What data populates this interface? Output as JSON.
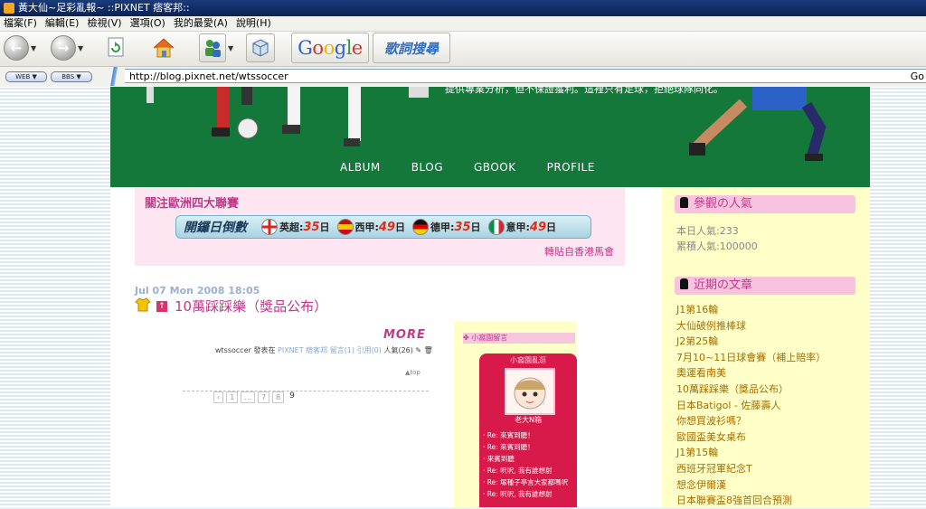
{
  "window": {
    "title": "黃大仙~足彩亂報~ ::PIXNET 痞客邦::"
  },
  "menu": [
    "檔案(F)",
    "編輯(E)",
    "檢視(V)",
    "選項(O)",
    "我的最愛(A)",
    "說明(H)"
  ],
  "toolbar": {
    "google_label": "Google",
    "lyrics_label": "歌詞搜尋",
    "web_label": "WEB",
    "bbs_label": "BBS"
  },
  "address": {
    "url": "http://blog.pixnet.net/wtssoccer",
    "go_label": "Go"
  },
  "header": {
    "tagline": "提供專業分析，但不保證獲利。這裡只有足球，拒絕球隊同化。",
    "nav": [
      "ALBUM",
      "BLOG",
      "GBOOK",
      "PROFILE"
    ]
  },
  "notice": {
    "heading": "關注歐洲四大聯賽",
    "countdown_title": "開鑼日倒數",
    "leagues": [
      {
        "name": "英超:",
        "days": "35",
        "unit": "日",
        "flag": "england-flag-icon"
      },
      {
        "name": "西甲:",
        "days": "49",
        "unit": "日",
        "flag": "spain-flag-icon"
      },
      {
        "name": "德甲:",
        "days": "35",
        "unit": "日",
        "flag": "germany-flag-icon"
      },
      {
        "name": "意甲:",
        "days": "49",
        "unit": "日",
        "flag": "italy-flag-icon"
      }
    ],
    "source": "轉貼自香港馬會"
  },
  "post": {
    "date": "Jul 07 Mon 2008 18:05",
    "title": "10萬踩踩樂（獎品公布）",
    "more_label": "MORE",
    "meta_author": "wtssoccer 發表在",
    "meta_link": "PIXNET 痞客邦 留言(1) 引用(0)",
    "meta_views": "人氣(26)",
    "top_label": "▲top"
  },
  "pager": [
    "‹",
    "1",
    "...",
    "7",
    "8",
    "9"
  ],
  "widget": {
    "bar_label": "小窩園留言",
    "guestbook_title": "小窩園亂逛",
    "guestbook_name": "老大N箱",
    "messages": [
      "Re: 來賓到聽！",
      "Re: 來賓到聽！",
      "來賓到聽",
      "Re: 呎呎, 我有誰想射",
      "Re: 塚種子亭言大家都嗎呎",
      "Re: 呎呎, 我有誰想射"
    ]
  },
  "sidebar": {
    "popularity_head": "參觀の人氣",
    "today": "本日人氣:233",
    "total": "累積人氣:100000",
    "recent_head": "近期の文章",
    "articles": [
      "J1第16輪",
      "大仙破例推棒球",
      "J2第25輪",
      "7月10~11日球會賽（補上賠率）",
      "奧運看南美",
      "10萬踩踩樂（獎品公布）",
      "日本Batigol - 佐藤壽人",
      "你想買波衫嗎？",
      "歐國盃美女桌布",
      "J1第15輪",
      "西班牙冠軍紀念T",
      "想念伊爾漢",
      "日本聯賽盃8強首回合預測"
    ]
  }
}
